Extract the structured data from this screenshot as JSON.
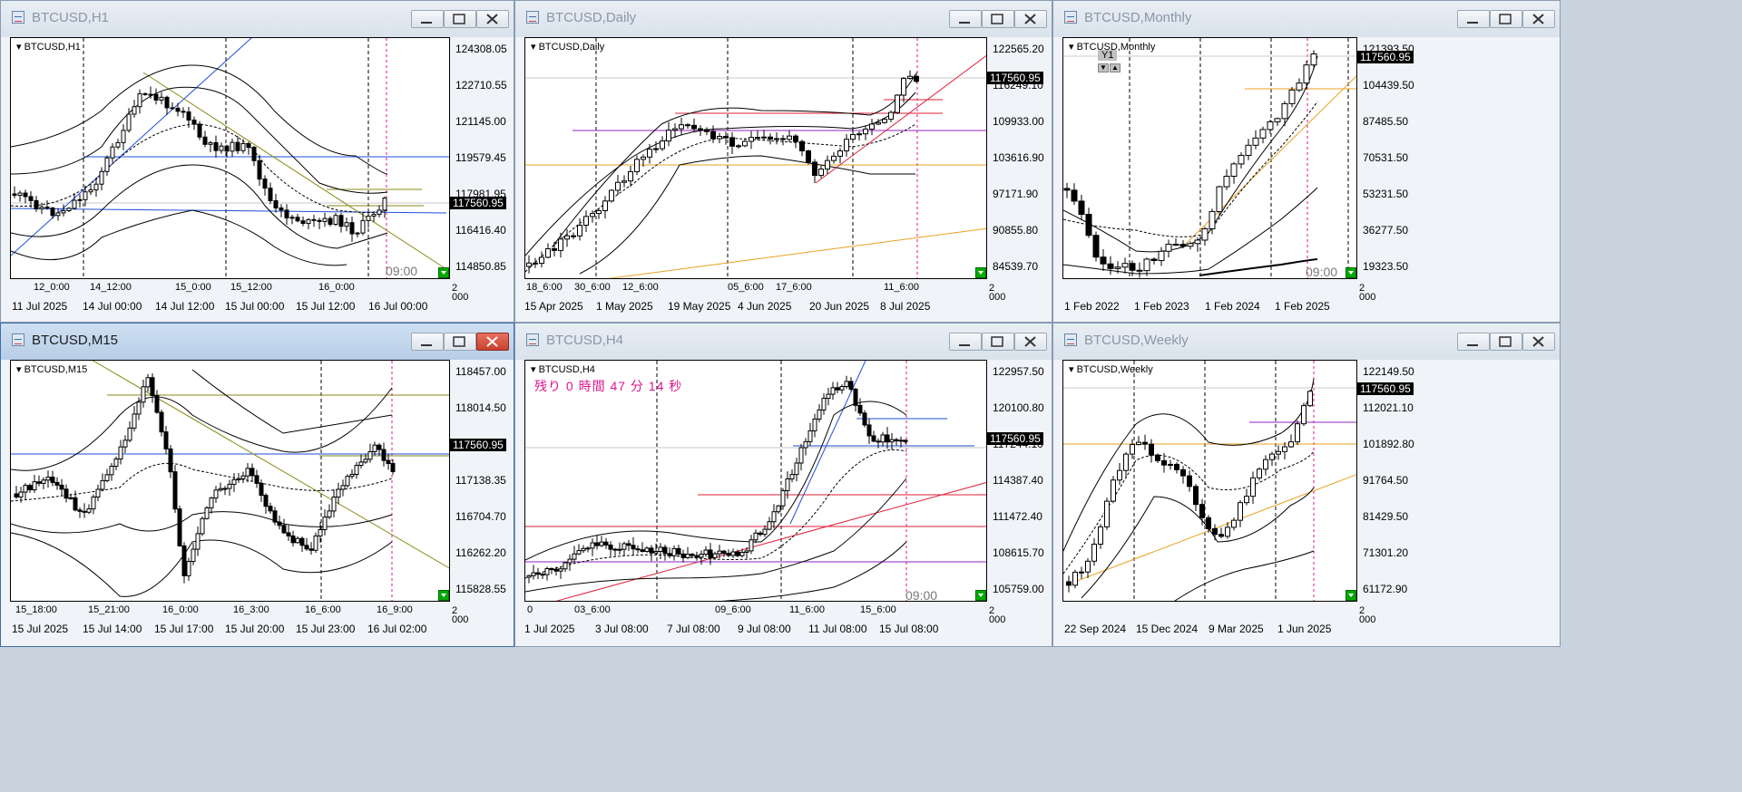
{
  "windows": [
    {
      "title": "BTCUSD,H1",
      "symbol": "BTCUSD,H1",
      "active": false,
      "price_tag": "117560.95",
      "y_labels": [
        "124308.05",
        "122710.55",
        "121145.00",
        "119579.45",
        "117981.95",
        "116416.40",
        "114850.85"
      ],
      "x_top": [
        "12_0:00",
        "14_12:00",
        "15_0:00",
        "15_12:00",
        "16_0:00"
      ],
      "x_bottom": [
        "11 Jul 2025",
        "14 Jul 00:00",
        "14 Jul 12:00",
        "15 Jul 00:00",
        "15 Jul 12:00",
        "16 Jul 00:00"
      ],
      "clock": "09:00",
      "corner": [
        "2",
        "0",
        "00"
      ]
    },
    {
      "title": "BTCUSD,Daily",
      "symbol": "BTCUSD,Daily",
      "active": false,
      "price_tag": "117560.95",
      "y_labels": [
        "122565.20",
        "116249.10",
        "109933.00",
        "103616.90",
        "97171.90",
        "90855.80",
        "84539.70"
      ],
      "x_top": [
        "18_6:00",
        "30_6:00",
        "12_6:00",
        "05_6:00",
        "17_6:00",
        "11_6:00"
      ],
      "x_bottom": [
        "15 Apr 2025",
        "1 May 2025",
        "19 May 2025",
        "4 Jun 2025",
        "20 Jun 2025",
        "8 Jul 2025"
      ],
      "clock": "",
      "corner": [
        "2",
        "0",
        "00"
      ]
    },
    {
      "title": "BTCUSD,Monthly",
      "symbol": "BTCUSD,Monthly",
      "active": false,
      "price_tag": "117560.95",
      "y_labels": [
        "121393.50",
        "104439.50",
        "87485.50",
        "70531.50",
        "53231.50",
        "36277.50",
        "19323.50"
      ],
      "x_top": [],
      "x_bottom": [
        "1 Feb 2022",
        "1 Feb 2023",
        "1 Feb 2024",
        "1 Feb 2025"
      ],
      "clock": "09:00",
      "corner": [
        "2",
        "0",
        "00"
      ],
      "zoom": "Y1"
    },
    {
      "title": "BTCUSD,M15",
      "symbol": "BTCUSD,M15",
      "active": true,
      "price_tag": "117560.95",
      "y_labels": [
        "118457.00",
        "118014.50",
        "117138.35",
        "116704.70",
        "116262.20",
        "115828.55"
      ],
      "x_top": [
        "15_18:00",
        "15_21:00",
        "16_0:00",
        "16_3:00",
        "16_6:00",
        "16_9:00"
      ],
      "x_bottom": [
        "15 Jul 2025",
        "15 Jul 14:00",
        "15 Jul 17:00",
        "15 Jul 20:00",
        "15 Jul 23:00",
        "16 Jul 02:00"
      ],
      "clock": "",
      "corner": [
        "2",
        "0",
        "00"
      ]
    },
    {
      "title": "BTCUSD,H4",
      "symbol": "BTCUSD,H4",
      "active": false,
      "price_tag": "117560.95",
      "y_labels": [
        "122957.50",
        "120100.80",
        "117244.10",
        "114387.40",
        "111472.40",
        "108615.70",
        "105759.00"
      ],
      "x_top": [
        "0",
        "03_6:00",
        "09_6:00",
        "11_6:00",
        "15_6:00"
      ],
      "x_bottom": [
        "1 Jul 2025",
        "3 Jul 08:00",
        "7 Jul 08:00",
        "9 Jul 08:00",
        "11 Jul 08:00",
        "15 Jul 08:00"
      ],
      "clock": "09:00",
      "corner": [
        "2",
        "0",
        "00"
      ],
      "countdown": "残り 0 時間 47 分 14 秒"
    },
    {
      "title": "BTCUSD,Weekly",
      "symbol": "BTCUSD,Weekly",
      "active": false,
      "price_tag": "117560.95",
      "y_labels": [
        "122149.50",
        "112021.10",
        "101892.80",
        "91764.50",
        "81429.50",
        "71301.20",
        "61172.90"
      ],
      "x_top": [],
      "x_bottom": [
        "22 Sep 2024",
        "15 Dec 2024",
        "9 Mar 2025",
        "1 Jun 2025"
      ],
      "clock": "",
      "corner": [
        "2",
        "0",
        "00"
      ]
    }
  ],
  "colors": {
    "bull": "#ffffff",
    "bear": "#000000",
    "band": "#000000",
    "blue": "#1e4fd8",
    "olive": "#8a8a1a",
    "orange": "#e8a020",
    "red": "#e0203a",
    "purple": "#9020c0",
    "magenta": "#e0158c"
  }
}
